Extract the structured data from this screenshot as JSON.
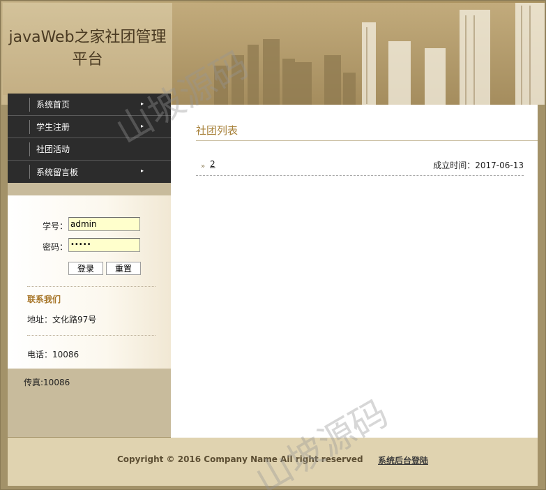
{
  "app": {
    "title": "javaWeb之家社团管理平台"
  },
  "nav": {
    "items": [
      {
        "label": "系统首页",
        "arrow": "▸",
        "has_arrow": true
      },
      {
        "label": "学生注册",
        "arrow": "▸",
        "has_arrow": true
      },
      {
        "label": "社团活动",
        "arrow": "",
        "has_arrow": false
      },
      {
        "label": "系统留言板",
        "arrow": "▸",
        "has_arrow": true
      }
    ]
  },
  "login": {
    "id_label": "学号：",
    "id_value": "admin",
    "pwd_label": "密码：",
    "pwd_value": "•••••",
    "login_button": "登录",
    "reset_button": "重置"
  },
  "contact": {
    "title": "联系我们",
    "address": "地址：文化路97号",
    "phone": "电话：10086",
    "fax": "传真:10086"
  },
  "main": {
    "title": "社团列表",
    "list": [
      {
        "bullet": "»",
        "name": "2",
        "date": "成立时间：2017-06-13"
      }
    ]
  },
  "footer": {
    "copyright": "Copyright © 2016 Company Name All right reserved",
    "admin_link": "系统后台登陆"
  },
  "watermark": {
    "text": "山坡源码"
  },
  "colors": {
    "nav_bg": "#2c2c2c",
    "accent": "#a8823b",
    "frame": "#a39269",
    "footer_bg": "#e0d3b0",
    "input_bg": "#ffffcc"
  },
  "icons": {
    "nav_arrow": "triangle-right-icon",
    "list_bullet": "double-chevron-icon"
  }
}
